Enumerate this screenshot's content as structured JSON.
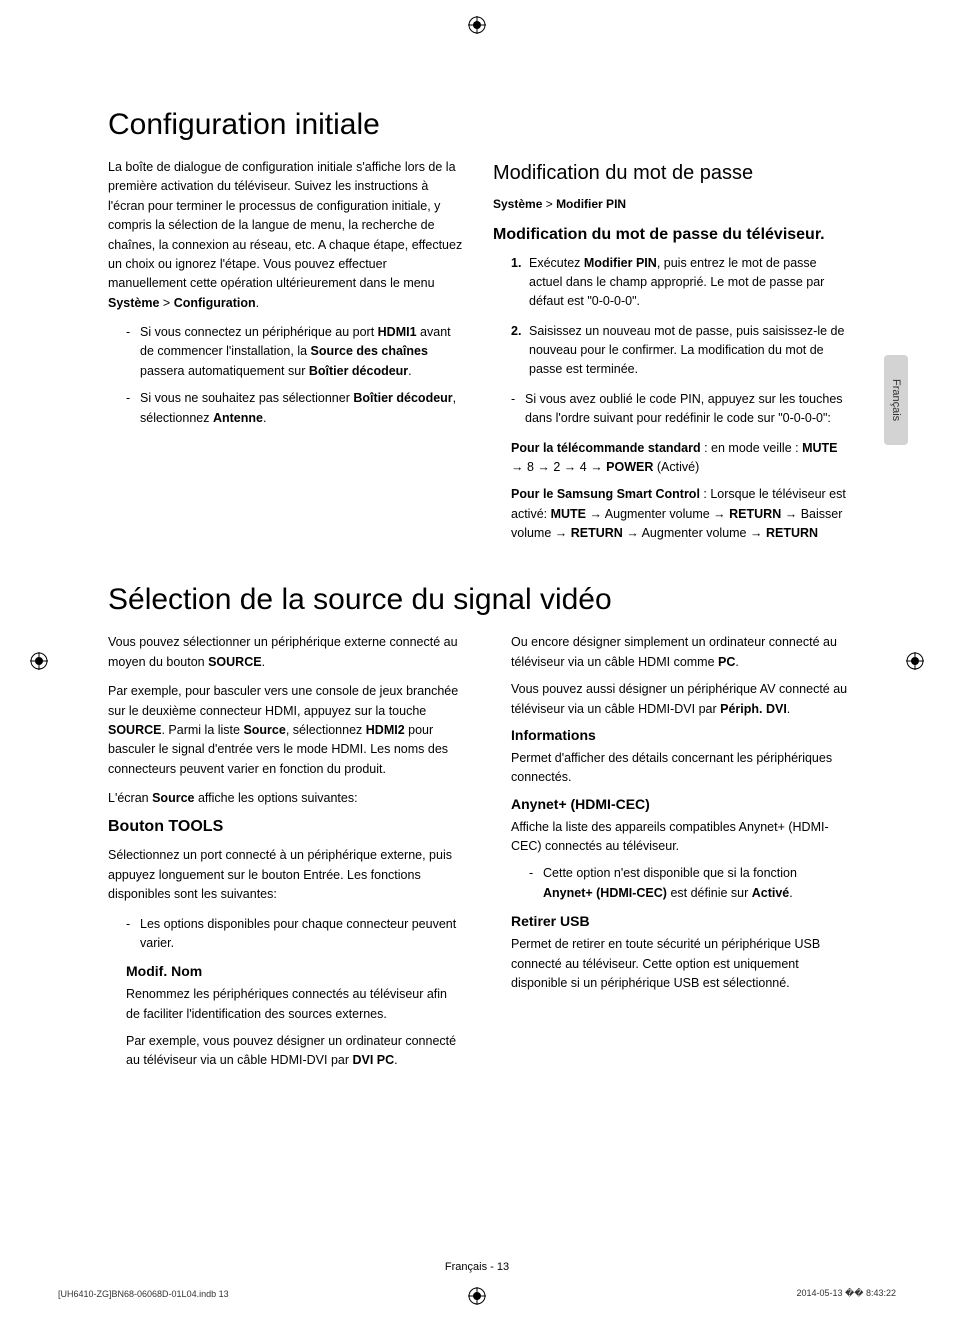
{
  "lang_tab": "Français",
  "section1": {
    "heading": "Configuration initiale",
    "left": {
      "intro": "La boîte de dialogue de configuration initiale s'affiche lors de la première activation du téléviseur. Suivez les instructions à l'écran pour terminer le processus de configuration initiale, y compris la sélection de la langue de menu, la recherche de chaînes, la connexion au réseau, etc. A chaque étape, effectuez un choix ou ignorez l'étape. Vous pouvez effectuer manuellement cette opération ultérieurement dans le menu ",
      "intro_b1": "Système",
      "intro_sep": " > ",
      "intro_b2": "Configuration",
      "intro_end": ".",
      "bul1_a": "Si vous connectez un périphérique au port ",
      "bul1_b1": "HDMI1",
      "bul1_b": " avant de commencer l'installation, la ",
      "bul1_b2": "Source des chaînes",
      "bul1_c": " passera automatiquement sur ",
      "bul1_b3": "Boîtier décodeur",
      "bul1_d": ".",
      "bul2_a": "Si vous ne souhaitez pas sélectionner ",
      "bul2_b1": "Boîtier décodeur",
      "bul2_b": ", sélectionnez ",
      "bul2_b2": "Antenne",
      "bul2_c": "."
    },
    "right": {
      "heading": "Modification du mot de passe",
      "breadcrumb_a": "Système",
      "breadcrumb_sep": " > ",
      "breadcrumb_b": "Modifier PIN",
      "subheading": "Modification du mot de passe du téléviseur.",
      "step1_a": "Exécutez ",
      "step1_b": "Modifier PIN",
      "step1_c": ", puis entrez le mot de passe actuel dans le champ approprié. Le mot de passe par défaut est \"0-0-0-0\".",
      "step2": "Saisissez un nouveau mot de passe, puis saisissez-le de nouveau pour le confirmer. La modification du mot de passe est terminée.",
      "note1": "Si vous avez oublié le code PIN, appuyez sur les touches dans l'ordre suivant pour redéfinir le code sur \"0-0-0-0\":",
      "std_a": "Pour la télécommande standard",
      "std_b": " : en mode veille : ",
      "std_c": "MUTE",
      "std_d": " → 8 → 2 → 4 → ",
      "std_e": "POWER",
      "std_f": " (Activé)",
      "smart_a": "Pour le Samsung Smart Control",
      "smart_b": " : Lorsque le téléviseur est activé: ",
      "smart_c": "MUTE",
      "smart_d": " → Augmenter volume → ",
      "smart_e": "RETURN",
      "smart_f": " → Baisser volume → ",
      "smart_g": "RETURN",
      "smart_h": " → Augmenter volume → ",
      "smart_i": "RETURN"
    }
  },
  "section2": {
    "heading": "Sélection de la source du signal vidéo",
    "left": {
      "p1_a": "Vous pouvez sélectionner un périphérique externe connecté au moyen du bouton ",
      "p1_b": "SOURCE",
      "p1_c": ".",
      "p2_a": "Par exemple, pour basculer vers une console de jeux branchée sur le deuxième connecteur HDMI, appuyez sur la touche ",
      "p2_b": "SOURCE",
      "p2_c": ". Parmi la liste ",
      "p2_d": "Source",
      "p2_e": ", sélectionnez ",
      "p2_f": "HDMI2",
      "p2_g": " pour basculer le signal d'entrée vers le mode HDMI. Les noms des connecteurs peuvent varier en fonction du produit.",
      "p3_a": "L'écran ",
      "p3_b": "Source",
      "p3_c": " affiche les options suivantes:",
      "tools_heading": "Bouton TOOLS",
      "tools_p": "Sélectionnez un port connecté à un périphérique externe, puis appuyez longuement sur le bouton Entrée. Les fonctions disponibles sont les suivantes:",
      "tools_bul1": "Les options disponibles pour chaque connecteur peuvent varier.",
      "modif_heading": "Modif. Nom",
      "modif_p1": "Renommez les périphériques connectés au téléviseur afin de faciliter l'identification des sources externes.",
      "modif_p2_a": "Par exemple, vous pouvez désigner un ordinateur connecté au téléviseur via un câble HDMI-DVI par ",
      "modif_p2_b": "DVI PC",
      "modif_p2_c": "."
    },
    "right": {
      "p1_a": "Ou encore désigner simplement un ordinateur connecté au téléviseur via un câble HDMI comme ",
      "p1_b": "PC",
      "p1_c": ".",
      "p2_a": "Vous pouvez aussi désigner un périphérique AV connecté au téléviseur via un câble HDMI-DVI par ",
      "p2_b": "Périph. DVI",
      "p2_c": ".",
      "info_heading": "Informations",
      "info_p": "Permet d'afficher des détails concernant les périphériques connectés.",
      "anynet_heading": "Anynet+ (HDMI-CEC)",
      "anynet_p": "Affiche la liste des appareils compatibles Anynet+ (HDMI-CEC) connectés au téléviseur.",
      "anynet_bul_a": "Cette option n'est disponible que si la fonction ",
      "anynet_bul_b": "Anynet+ (HDMI-CEC)",
      "anynet_bul_c": " est définie sur ",
      "anynet_bul_d": "Activé",
      "anynet_bul_e": ".",
      "usb_heading": "Retirer USB",
      "usb_p": "Permet de retirer en toute sécurité un périphérique USB connecté au téléviseur. Cette option est uniquement disponible si un périphérique USB est sélectionné."
    }
  },
  "footer": {
    "page_num": "Français - 13",
    "left": "[UH6410-ZG]BN68-06068D-01L04.indb   13",
    "right": "2014-05-13   ‭�� 8:43:22"
  }
}
